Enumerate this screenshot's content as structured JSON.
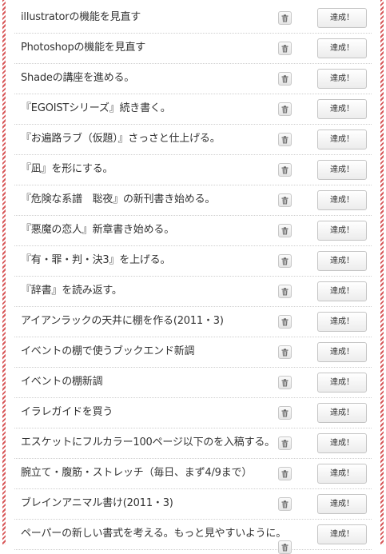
{
  "tasks": [
    {
      "label": "illustratorの機能を見直す",
      "done_label": "達成！"
    },
    {
      "label": "Photoshopの機能を見直す",
      "done_label": "達成！"
    },
    {
      "label": "Shadeの講座を進める。",
      "done_label": "達成！"
    },
    {
      "label": "『EGOISTシリーズ』続き書く。",
      "done_label": "達成！"
    },
    {
      "label": "『お遍路ラブ（仮題）』さっさと仕上げる。",
      "done_label": "達成！"
    },
    {
      "label": "『凪』を形にする。",
      "done_label": "達成！"
    },
    {
      "label": "『危険な系譜　聡夜』の新刊書き始める。",
      "done_label": "達成！"
    },
    {
      "label": "『悪魔の恋人』新章書き始める。",
      "done_label": "達成！"
    },
    {
      "label": "『有・罪・判・決3』を上げる。",
      "done_label": "達成！"
    },
    {
      "label": "『辞書』を読み返す。",
      "done_label": "達成！"
    },
    {
      "label": "アイアンラックの天井に棚を作る(2011・3)",
      "done_label": "達成！"
    },
    {
      "label": "イベントの棚で使うブックエンド新調",
      "done_label": "達成！"
    },
    {
      "label": "イベントの棚新調",
      "done_label": "達成！"
    },
    {
      "label": "イラレガイドを買う",
      "done_label": "達成！"
    },
    {
      "label": "エスケットにフルカラー100ページ以下のを入稿する。",
      "done_label": "達成！"
    },
    {
      "label": "腕立て・腹筋・ストレッチ（毎日、まず4/9まで）",
      "done_label": "達成！"
    },
    {
      "label": "ブレインアニマル書け(2011・3)",
      "done_label": "達成！"
    },
    {
      "label": "ペーパーの新しい書式を考える。もっと見やすいように。",
      "done_label": "達成！"
    }
  ],
  "icons": {
    "delete": "trash-icon"
  },
  "colors": {
    "stripe": "#d8585a",
    "text": "#333333",
    "divider": "#cfcfcf"
  }
}
